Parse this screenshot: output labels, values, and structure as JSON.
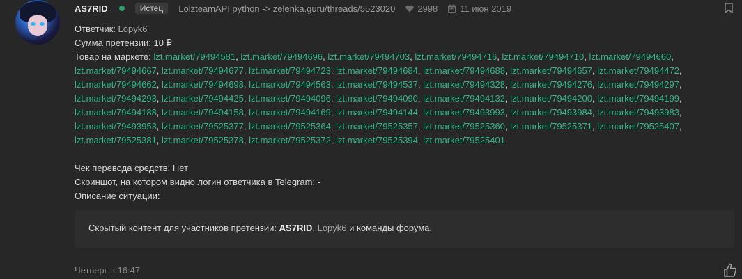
{
  "post": {
    "author": "AS7RID",
    "role_badge": "Истец",
    "thread_link": "LolzteamAPI python -> zelenka.guru/threads/5523020",
    "likes_count": "2998",
    "date": "11 июн 2019",
    "status_color": "#2e9b6c"
  },
  "body": {
    "respondent_label": "Ответчик:",
    "respondent_name": "Lopyk6",
    "claim_amount_label": "Сумма претензии:",
    "claim_amount_value": "10 ₽",
    "market_label": "Товар на маркете:",
    "market_lines": [
      [
        "lzt.market/79494581",
        "lzt.market/79494696",
        "lzt.market/79494703",
        "lzt.market/79494716",
        "lzt.market/79494710",
        "lzt.market/79494660"
      ],
      [
        "lzt.market/79494667",
        "lzt.market/79494677",
        "lzt.market/79494723",
        "lzt.market/79494684",
        "lzt.market/79494688",
        "lzt.market/79494657",
        "lzt.market/79494472"
      ],
      [
        "lzt.market/79494662",
        "lzt.market/79494698",
        "lzt.market/79494563",
        "lzt.market/79494537",
        "lzt.market/79494328",
        "lzt.market/79494276",
        "lzt.market/79494297"
      ],
      [
        "lzt.market/79494293",
        "lzt.market/79494425",
        "lzt.market/79494096",
        "lzt.market/79494090",
        "lzt.market/79494132",
        "lzt.market/79494200",
        "lzt.market/79494199"
      ],
      [
        "lzt.market/79494188",
        "lzt.market/79494158",
        "lzt.market/79494169",
        "lzt.market/79494144",
        "lzt.market/79493993",
        "lzt.market/79493984",
        "lzt.market/79493983"
      ],
      [
        "lzt.market/79493953",
        "lzt.market/79525377",
        "lzt.market/79525364",
        "lzt.market/79525357",
        "lzt.market/79525360",
        "lzt.market/79525371",
        "lzt.market/79525407"
      ],
      [
        "lzt.market/79525381",
        "lzt.market/79525378",
        "lzt.market/79525372",
        "lzt.market/79525394",
        "lzt.market/79525401"
      ]
    ],
    "transfer_receipt": "Чек перевода средств: Нет",
    "screenshot_line": "Скриншот, на котором видно логин ответчика в Telegram: -",
    "description_label": "Описание ситуации:"
  },
  "hidden": {
    "prefix": "Скрытый контент для участников претензии:",
    "user1": "AS7RID",
    "separator": ",",
    "user2": "Lopyk6",
    "suffix": "и команды форума."
  },
  "footer": {
    "time": "Четверг в 16:47"
  },
  "icons": {
    "likes": "heart-icon",
    "date": "calendar-icon",
    "bookmark": "bookmark-icon",
    "like": "thumbs-up-icon"
  },
  "colors": {
    "background": "#272727",
    "link": "#2bb58b",
    "text": "#d6d6d6"
  }
}
